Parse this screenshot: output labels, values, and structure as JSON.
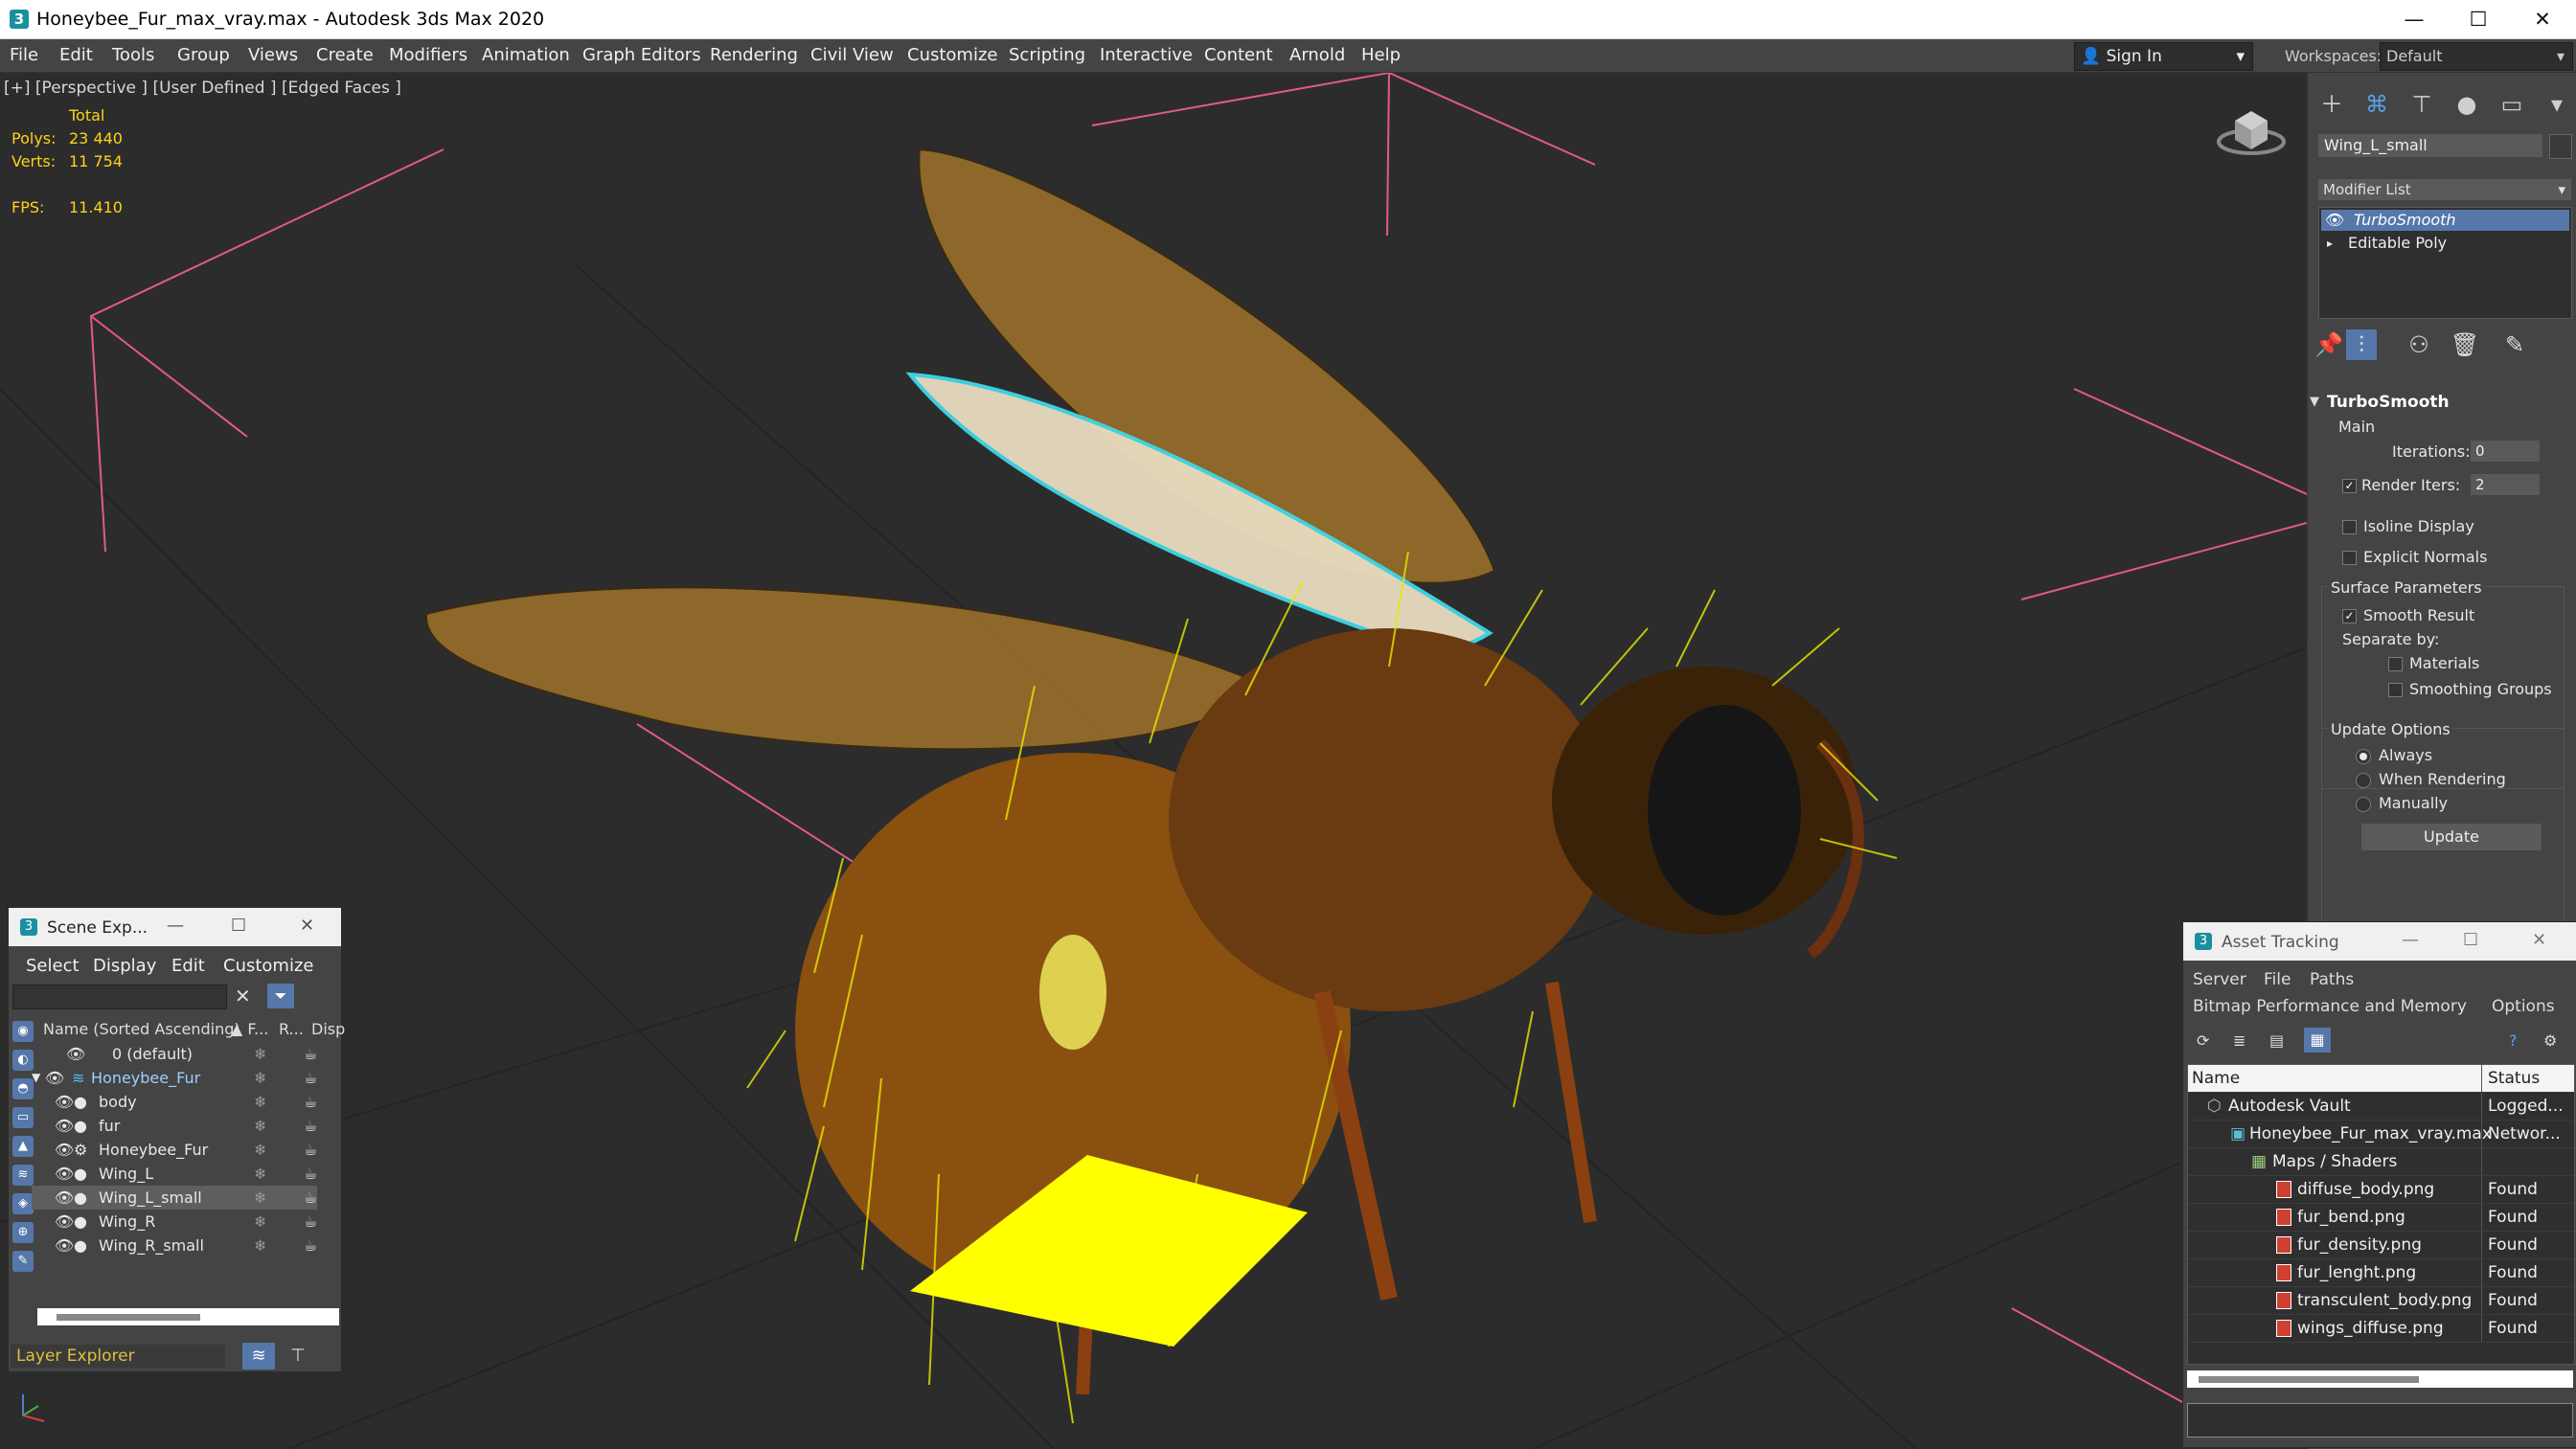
{
  "window": {
    "title": "Honeybee_Fur_max_vray.max - Autodesk 3ds Max 2020",
    "minimize": "—",
    "maximize": "☐",
    "close": "✕"
  },
  "menu": [
    "File",
    "Edit",
    "Tools",
    "Group",
    "Views",
    "Create",
    "Modifiers",
    "Animation",
    "Graph Editors",
    "Rendering",
    "Civil View",
    "Customize",
    "Scripting",
    "Interactive",
    "Content",
    "Arnold",
    "Help"
  ],
  "signin": {
    "label": "Sign In"
  },
  "workspaces": {
    "label": "Workspaces:",
    "value": "Default"
  },
  "viewport": {
    "label": "[+] [Perspective ] [User Defined ] [Edged Faces ]",
    "stats": {
      "total_label": "Total",
      "polys_label": "Polys:",
      "polys_value": "23 440",
      "verts_label": "Verts:",
      "verts_value": "11 754",
      "fps_label": "FPS:",
      "fps_value": "11.410"
    }
  },
  "command_panel": {
    "object_name": "Wing_L_small",
    "modifier_list": "Modifier List",
    "stack": [
      "TurboSmooth",
      "Editable Poly"
    ],
    "turbosmooth": {
      "title": "TurboSmooth",
      "main_label": "Main",
      "iterations_label": "Iterations:",
      "iterations_value": "0",
      "render_iters_label": "Render Iters:",
      "render_iters_value": "2",
      "isoline_label": "Isoline Display",
      "explicit_normals_label": "Explicit Normals",
      "surface_params_label": "Surface Parameters",
      "smooth_result_label": "Smooth Result",
      "separate_by_label": "Separate by:",
      "materials_label": "Materials",
      "smoothing_groups_label": "Smoothing Groups",
      "update_options_label": "Update Options",
      "always_label": "Always",
      "when_rendering_label": "When Rendering",
      "manually_label": "Manually",
      "update_button": "Update"
    }
  },
  "scene_explorer": {
    "title": "Scene Exp...",
    "menu": [
      "Select",
      "Display",
      "Edit",
      "Customize"
    ],
    "col_name": "Name (Sorted Ascending)",
    "col_f": "▲ F...",
    "col_r": "R...",
    "col_disp": "Disp",
    "rows": [
      "0 (default)",
      "Honeybee_Fur",
      "body",
      "fur",
      "Honeybee_Fur",
      "Wing_L",
      "Wing_L_small",
      "Wing_R",
      "Wing_R_small"
    ],
    "footer": "Layer Explorer"
  },
  "asset_tracking": {
    "title": "Asset Tracking",
    "menu1": [
      "Server",
      "File",
      "Paths"
    ],
    "menu2": [
      "Bitmap Performance and Memory",
      "Options"
    ],
    "col_name": "Name",
    "col_status": "Status",
    "rows": [
      {
        "name": "Autodesk Vault",
        "status": "Logged..."
      },
      {
        "name": "Honeybee_Fur_max_vray.max",
        "status": "Networ..."
      },
      {
        "name": "Maps / Shaders",
        "status": ""
      },
      {
        "name": "diffuse_body.png",
        "status": "Found"
      },
      {
        "name": "fur_bend.png",
        "status": "Found"
      },
      {
        "name": "fur_density.png",
        "status": "Found"
      },
      {
        "name": "fur_lenght.png",
        "status": "Found"
      },
      {
        "name": "transculent_body.png",
        "status": "Found"
      },
      {
        "name": "wings_diffuse.png",
        "status": "Found"
      }
    ]
  },
  "colors": {
    "selection": "#5577aa",
    "wing_highlight": "#3ed8e8",
    "stat_text": "#ffd21a",
    "fur": "#e8e800"
  }
}
